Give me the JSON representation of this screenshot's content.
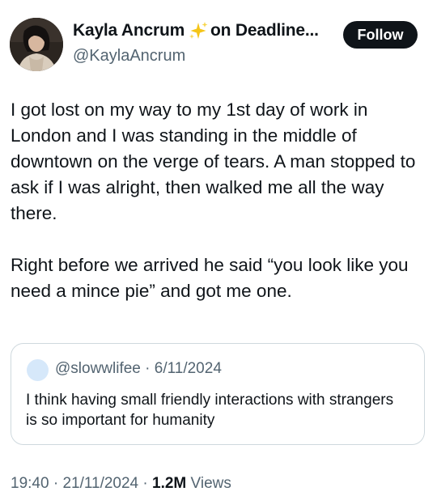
{
  "author": {
    "name": "Kayla Ancrum",
    "name_suffix": "on Deadline...",
    "emoji_icon": "sparkles-icon",
    "handle": "@KaylaAncrum"
  },
  "follow_label": "Follow",
  "tweet": {
    "paragraphs": [
      "I got lost on my way to my 1st day of work in London and I was standing in the middle of downtown on the verge of tears. A man stopped to ask if I was alright, then walked me all the way there.",
      "Right before we arrived he said “you look like you need a mince pie” and got me one."
    ]
  },
  "quote": {
    "handle": "@slowwlifee",
    "separator": "·",
    "date": "6/11/2024",
    "text": "I think having small friendly interactions with strangers is so important for humanity"
  },
  "meta": {
    "time": "19:40",
    "separator": "·",
    "date": "21/11/2024",
    "views_count": "1.2M",
    "views_label": "Views"
  },
  "colors": {
    "text_primary": "#0f1419",
    "text_secondary": "#536471",
    "border": "#cfd9de",
    "follow_bg": "#0f1419",
    "sparkle": "#f5c518"
  }
}
